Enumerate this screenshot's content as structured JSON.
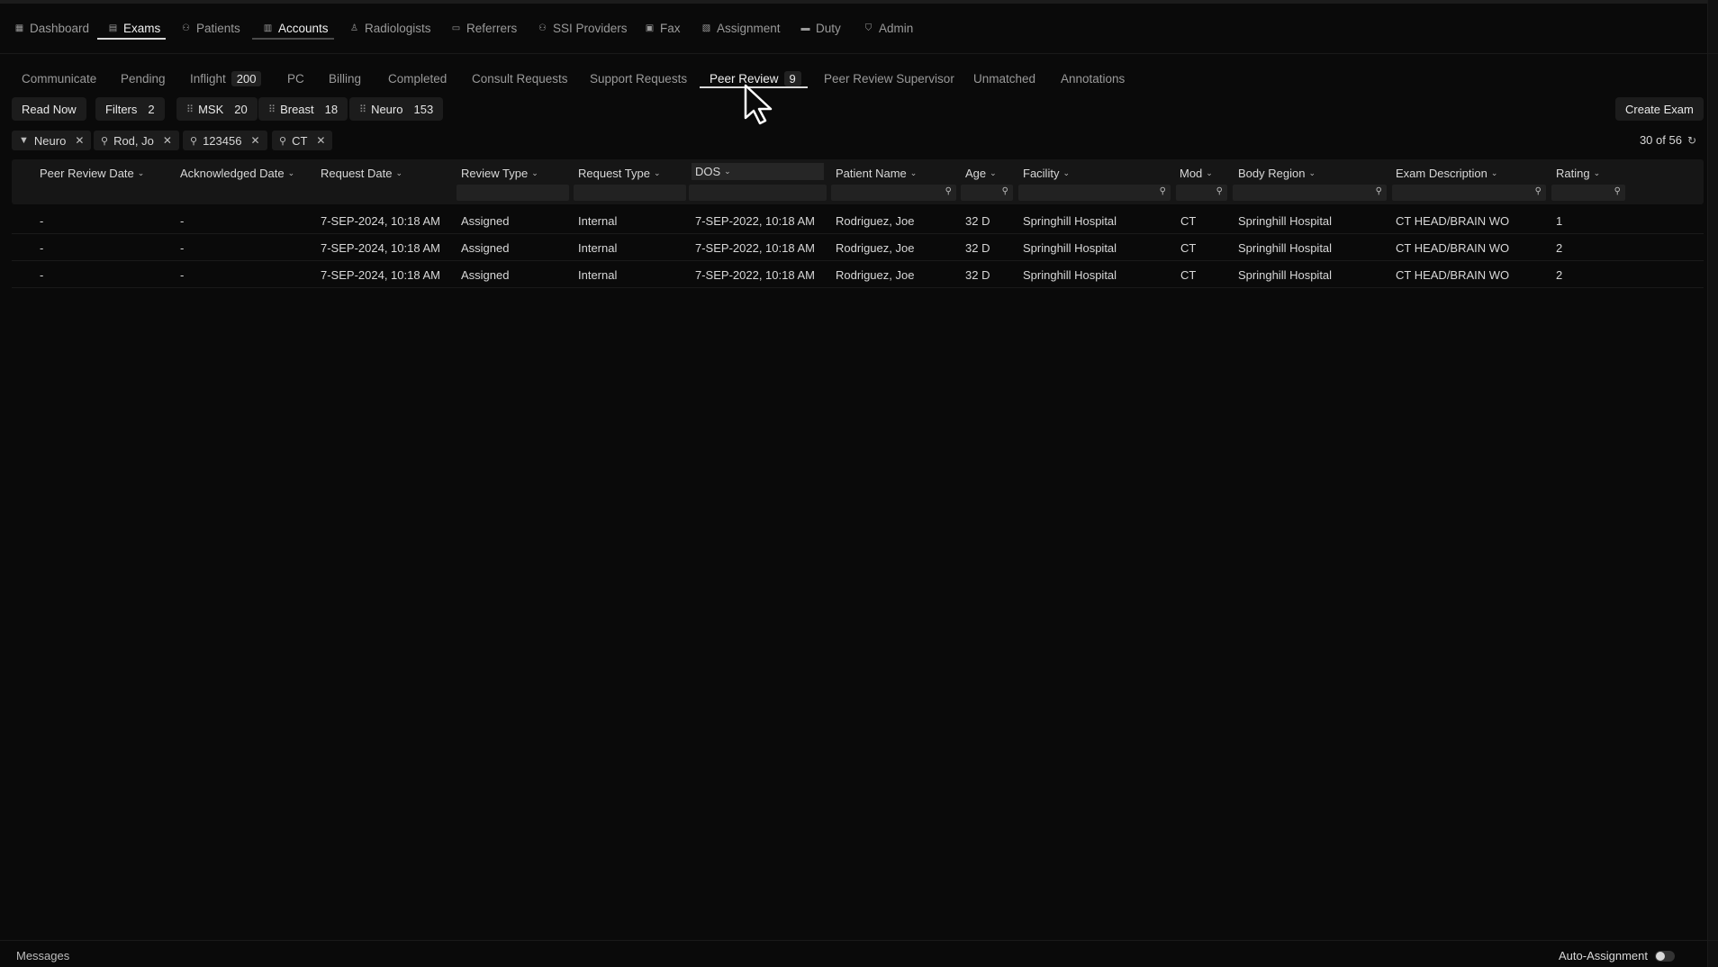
{
  "topnav": {
    "items": [
      {
        "label": "Dashboard",
        "icon": "grid-icon"
      },
      {
        "label": "Exams",
        "icon": "document-icon"
      },
      {
        "label": "Patients",
        "icon": "people-icon"
      },
      {
        "label": "Accounts",
        "icon": "building-icon"
      },
      {
        "label": "Radiologists",
        "icon": "person-icon"
      },
      {
        "label": "Referrers",
        "icon": "id-card-icon"
      },
      {
        "label": "SSI Providers",
        "icon": "group-icon"
      },
      {
        "label": "Fax",
        "icon": "fax-icon"
      },
      {
        "label": "Assignment",
        "icon": "clipboard-icon"
      },
      {
        "label": "Duty",
        "icon": "briefcase-icon"
      },
      {
        "label": "Admin",
        "icon": "shield-icon"
      }
    ],
    "active": "Exams"
  },
  "subtabs": {
    "items": [
      {
        "label": "Communicate"
      },
      {
        "label": "Pending"
      },
      {
        "label": "Inflight",
        "count": "200"
      },
      {
        "label": "PC"
      },
      {
        "label": "Billing"
      },
      {
        "label": "Completed"
      },
      {
        "label": "Consult Requests"
      },
      {
        "label": "Support Requests"
      },
      {
        "label": "Peer Review",
        "count": "9"
      },
      {
        "label": "Peer Review Supervisor"
      },
      {
        "label": "Unmatched"
      },
      {
        "label": "Annotations"
      }
    ],
    "active": "Peer Review"
  },
  "toolbar": {
    "read_now": "Read Now",
    "filters_label": "Filters",
    "filters_count": "2",
    "msk_label": "MSK",
    "msk_count": "20",
    "breast_label": "Breast",
    "breast_count": "18",
    "neuro_label": "Neuro",
    "neuro_count": "153",
    "create_exam": "Create Exam"
  },
  "chips": [
    {
      "label": "Neuro",
      "icon": "filter-icon"
    },
    {
      "label": "Rod, Jo",
      "icon": "search-icon"
    },
    {
      "label": "123456",
      "icon": "search-icon"
    },
    {
      "label": "CT",
      "icon": "search-icon"
    }
  ],
  "result_count": "30 of 56",
  "table": {
    "columns": [
      "Peer Review Date",
      "Acknowledged Date",
      "Request Date",
      "Review Type",
      "Request Type",
      "DOS",
      "Patient Name",
      "Age",
      "Facility",
      "Mod",
      "Body Region",
      "Exam Description",
      "Rating"
    ],
    "rows": [
      [
        "-",
        "-",
        "7-SEP-2024, 10:18 AM",
        "Assigned",
        "Internal",
        "7-SEP-2022, 10:18 AM",
        "Rodriguez, Joe",
        "32 D",
        "Springhill Hospital",
        "CT",
        "Springhill Hospital",
        "CT HEAD/BRAIN WO",
        "1"
      ],
      [
        "-",
        "-",
        "7-SEP-2024, 10:18 AM",
        "Assigned",
        "Internal",
        "7-SEP-2022, 10:18 AM",
        "Rodriguez, Joe",
        "32 D",
        "Springhill Hospital",
        "CT",
        "Springhill Hospital",
        "CT HEAD/BRAIN WO",
        "2"
      ],
      [
        "-",
        "-",
        "7-SEP-2024, 10:18 AM",
        "Assigned",
        "Internal",
        "7-SEP-2022, 10:18 AM",
        "Rodriguez, Joe",
        "32 D",
        "Springhill Hospital",
        "CT",
        "Springhill Hospital",
        "CT HEAD/BRAIN WO",
        "2"
      ]
    ]
  },
  "bottombar": {
    "messages": "Messages",
    "auto_assignment": "Auto-Assignment"
  }
}
